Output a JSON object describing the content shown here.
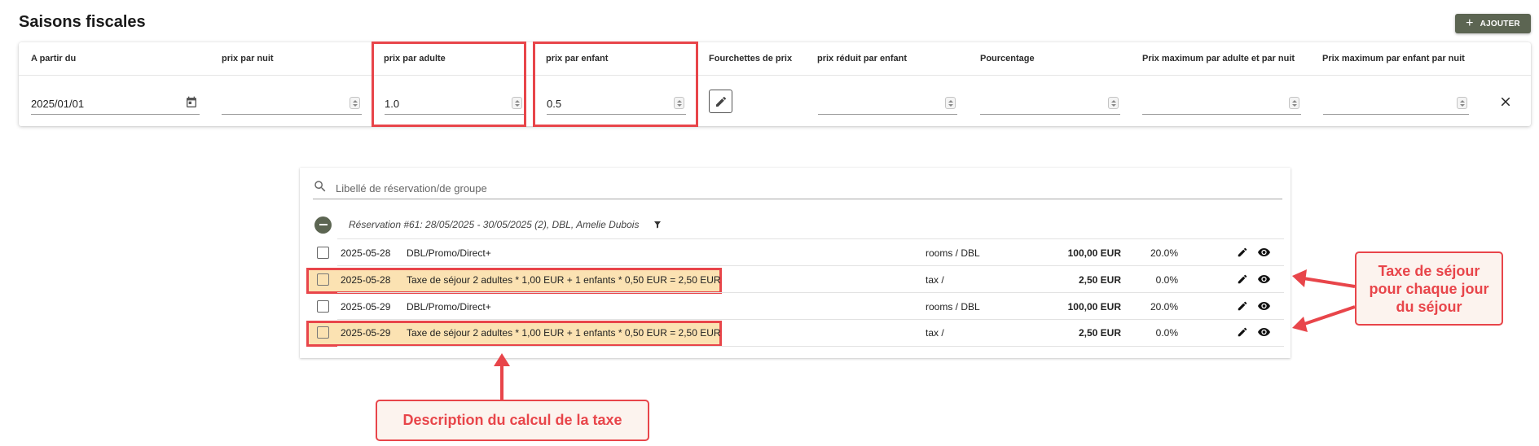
{
  "header": {
    "title": "Saisons fiscales",
    "add_label": "AJOUTER"
  },
  "season_table": {
    "columns": [
      "A partir du",
      "prix par nuit",
      "prix par adulte",
      "prix par enfant",
      "Fourchettes de prix",
      "prix réduit par enfant",
      "Pourcentage",
      "Prix maximum par adulte et par nuit",
      "Prix maximum par enfant par nuit"
    ],
    "row": {
      "start_date": "2025/01/01",
      "price_per_night": "",
      "price_per_adult": "1.0",
      "price_per_child": "0.5",
      "reduced_child_price": "",
      "percentage": "",
      "max_adult_per_night": "",
      "max_child_per_night": ""
    }
  },
  "reservations": {
    "search_placeholder": "Libellé de réservation/de groupe",
    "group_title": "Réservation #61: 28/05/2025 - 30/05/2025 (2), DBL, Amelie Dubois",
    "rows": [
      {
        "date": "2025-05-28",
        "description": "DBL/Promo/Direct+",
        "account": "rooms / DBL",
        "amount": "100,00 EUR",
        "vat": "20.0%",
        "is_tax": false
      },
      {
        "date": "2025-05-28",
        "description": "Taxe de séjour 2 adultes * 1,00 EUR + 1 enfants * 0,50 EUR = 2,50 EUR",
        "account": "tax /",
        "amount": "2,50 EUR",
        "vat": "0.0%",
        "is_tax": true
      },
      {
        "date": "2025-05-29",
        "description": "DBL/Promo/Direct+",
        "account": "rooms / DBL",
        "amount": "100,00 EUR",
        "vat": "20.0%",
        "is_tax": false
      },
      {
        "date": "2025-05-29",
        "description": "Taxe de séjour 2 adultes * 1,00 EUR + 1 enfants * 0,50 EUR = 2,50 EUR",
        "account": "tax /",
        "amount": "2,50 EUR",
        "vat": "0.0%",
        "is_tax": true
      }
    ]
  },
  "annotations": {
    "right_callout": [
      "Taxe de séjour",
      "pour chaque jour",
      "du séjour"
    ],
    "bottom_callout": "Description du calcul de la taxe"
  },
  "colors": {
    "accent": "#5c6552",
    "highlight_border": "#e8454a",
    "highlight_fill": "#fbe2b2",
    "callout_fill": "#fcf3ee"
  },
  "icons": [
    "plus-icon",
    "calendar-icon",
    "pencil-icon",
    "close-icon",
    "search-icon",
    "filter-icon",
    "eye-icon"
  ]
}
